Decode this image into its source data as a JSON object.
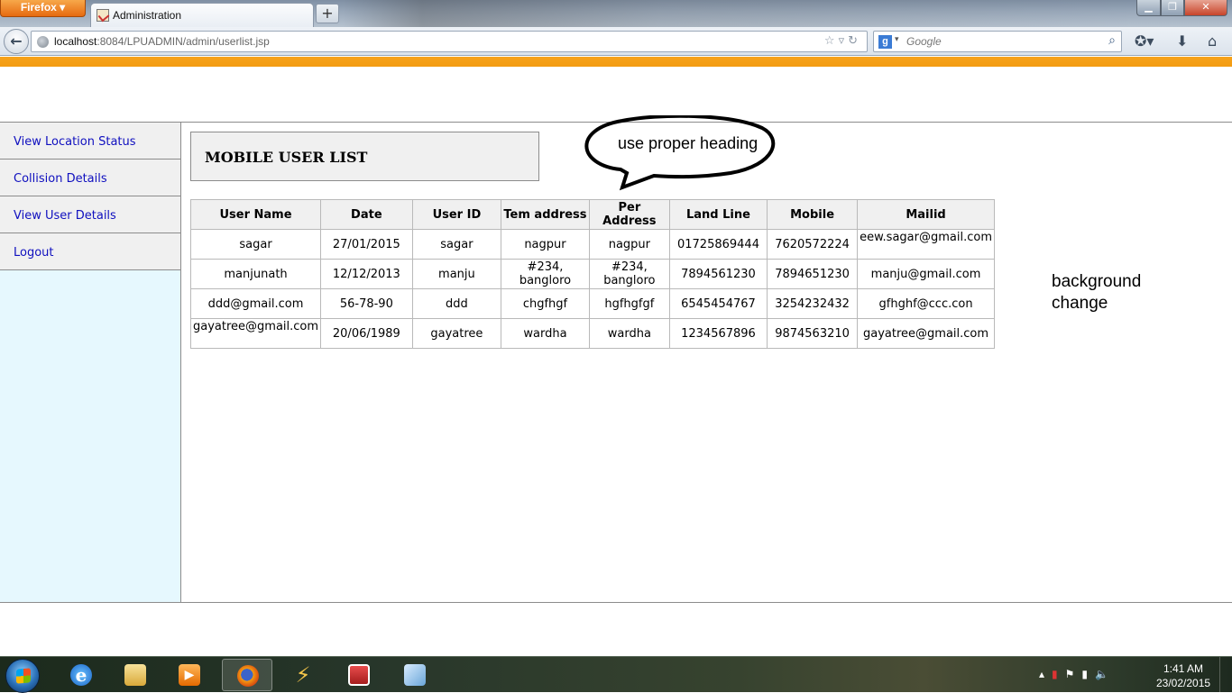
{
  "browser": {
    "app_button": "Firefox",
    "tab_title": "Administration",
    "url_host": "localhost",
    "url_rest": ":8084/LPUADMIN/admin/userlist.jsp",
    "search_placeholder": "Google"
  },
  "sidebar": {
    "items": [
      {
        "label": "View Location Status"
      },
      {
        "label": "Collision Details"
      },
      {
        "label": "View User Details"
      },
      {
        "label": "Logout"
      }
    ]
  },
  "main": {
    "title": "MOBILE USER LIST",
    "table": {
      "headers": [
        "User Name",
        "Date",
        "User ID",
        "Tem address",
        "Per Address",
        "Land Line",
        "Mobile",
        "Mailid"
      ],
      "rows": [
        [
          "sagar",
          "27/01/2015",
          "sagar",
          "nagpur",
          "nagpur",
          "01725869444",
          "7620572224",
          "eew.sagar@gmail.com"
        ],
        [
          "manjunath",
          "12/12/2013",
          "manju",
          "#234, bangloro",
          "#234, bangloro",
          "7894561230",
          "7894651230",
          "manju@gmail.com"
        ],
        [
          "ddd@gmail.com",
          "56-78-90",
          "ddd",
          "chgfhgf",
          "hgfhgfgf",
          "6545454767",
          "3254232432",
          "gfhghf@ccc.con"
        ],
        [
          "gayatree@gmail.com",
          "20/06/1989",
          "gayatree",
          "wardha",
          "wardha",
          "1234567896",
          "9874563210",
          "gayatree@gmail.com"
        ]
      ]
    }
  },
  "annotations": {
    "bubble": "use proper heading",
    "note_line1": "background",
    "note_line2": "change"
  },
  "taskbar": {
    "time": "1:41 AM",
    "date": "23/02/2015"
  },
  "icons": [
    "back-arrow-icon",
    "globe-icon",
    "star-icon",
    "reload-icon",
    "search-icon",
    "bookmarks-icon",
    "download-icon",
    "home-icon"
  ]
}
